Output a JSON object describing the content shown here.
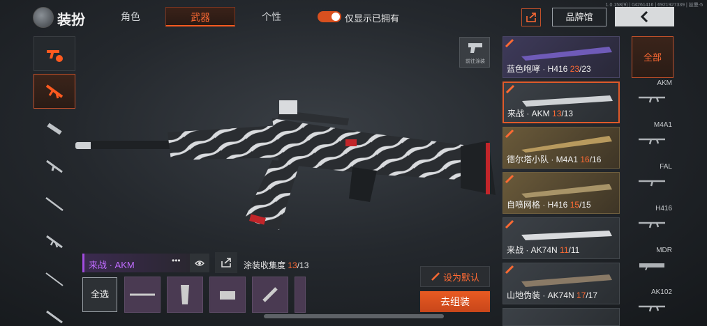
{
  "header": {
    "version": "1.0.158(9) | 04261416 | 6921927339 | 兹曼-5",
    "title": "装扮",
    "tabs": [
      {
        "label": "角色",
        "active": false
      },
      {
        "label": "武器",
        "active": true
      },
      {
        "label": "个性",
        "active": false
      }
    ],
    "toggle_label": "仅显示已拥有",
    "toggle_on": true,
    "brand_button": "品牌馆"
  },
  "goto_coating_label": "前往涂装",
  "selected_skin": {
    "name": "来战 · AKM",
    "collection_label": "涂装收集度",
    "collection_current": "13",
    "collection_total": "/13"
  },
  "select_all_label": "全选",
  "actions": {
    "set_default": "设为默认",
    "assemble": "去组装"
  },
  "skins": [
    {
      "name": "蓝色咆哮 · H416 ",
      "cur": "23",
      "total": "/23",
      "style": "purple"
    },
    {
      "name": "来战 · AKM ",
      "cur": "13",
      "total": "/13",
      "style": "grey",
      "active": true
    },
    {
      "name": "德尔塔小队 · M4A1 ",
      "cur": "16",
      "total": "/16",
      "style": "gold"
    },
    {
      "name": "自喷网格 · H416 ",
      "cur": "15",
      "total": "/15",
      "style": "gold"
    },
    {
      "name": "来战 · AK74N ",
      "cur": "11",
      "total": "/11",
      "style": "grey"
    },
    {
      "name": "山地伪装 · AK74N ",
      "cur": "17",
      "total": "/17",
      "style": "grey"
    }
  ],
  "weapon_types": {
    "all_label": "全部",
    "items": [
      "AKM",
      "M4A1",
      "FAL",
      "H416",
      "MDR",
      "AK102"
    ]
  },
  "colors": {
    "accent": "#ff6a33",
    "accent_dark": "#c2502a",
    "legendary_purple": "#a24ce0"
  }
}
